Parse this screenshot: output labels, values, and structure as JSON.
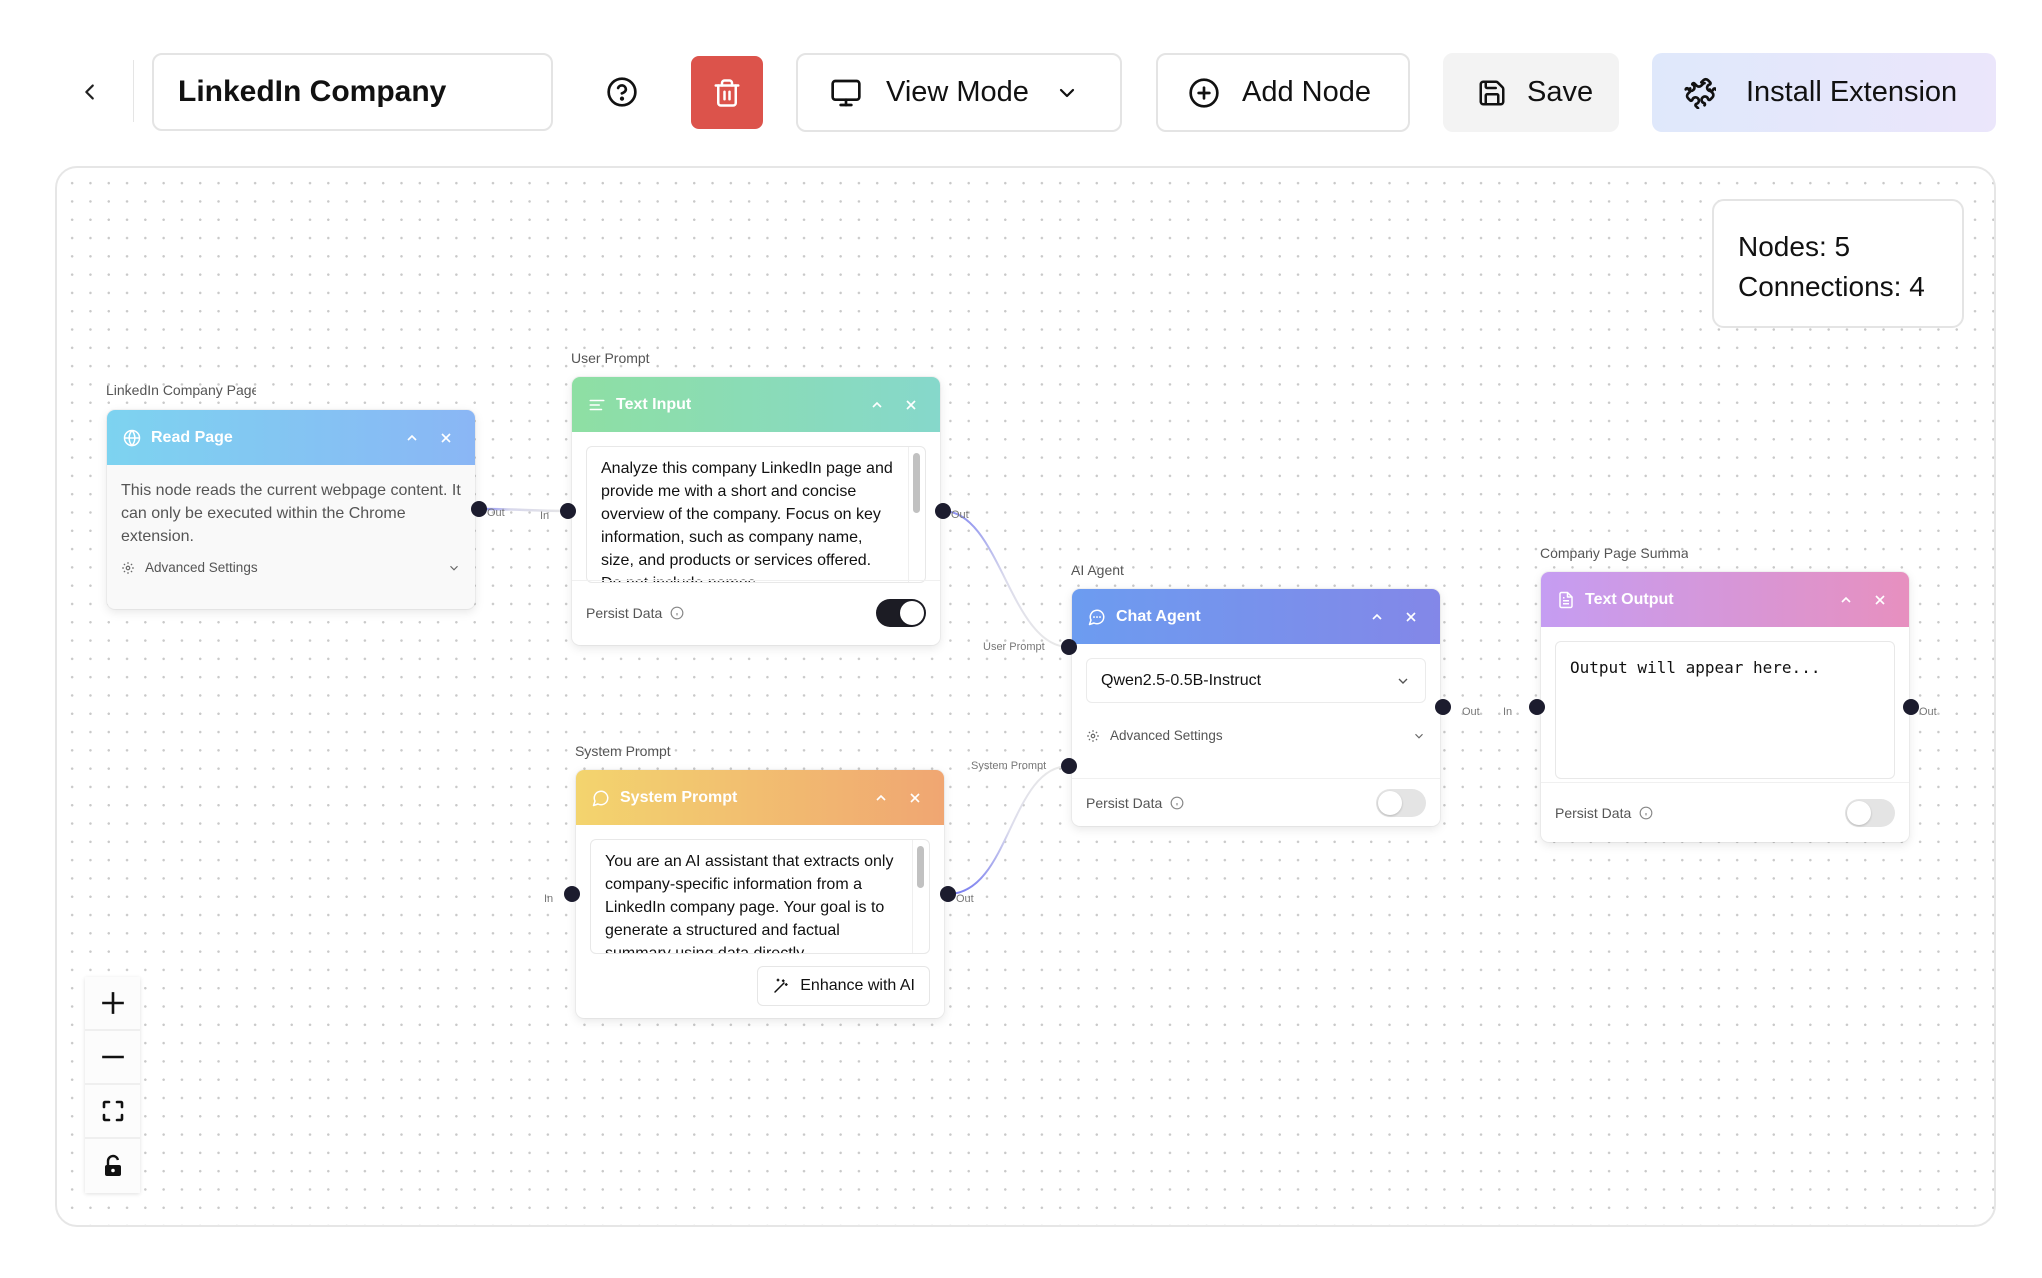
{
  "toolbar": {
    "back_icon": "chevron-left-icon",
    "title_value": "LinkedIn Company",
    "help_icon": "help-circle-icon",
    "delete_icon": "trash-icon",
    "view_mode_label": "View Mode",
    "view_mode_icon": "monitor-icon",
    "add_node_label": "Add Node",
    "add_node_icon": "plus-circle-icon",
    "save_label": "Save",
    "save_icon": "save-icon",
    "install_label": "Install Extension",
    "install_icon": "puzzle-icon"
  },
  "stats": {
    "nodes": "Nodes: 5",
    "connections": "Connections: 4"
  },
  "nodes": {
    "read_page": {
      "label": "LinkedIn Company Page",
      "title": "Read Page",
      "icon": "globe-icon",
      "header_colors": [
        "#7dd3f0",
        "#8ab6f5"
      ],
      "description": "This node reads the current webpage content. It can only be executed within the Chrome extension.",
      "advanced_settings": "Advanced Settings",
      "ports": {
        "out": "Out"
      }
    },
    "text_input": {
      "label": "User Prompt",
      "title": "Text Input",
      "icon": "text-align-icon",
      "header_colors": [
        "#8edfa3",
        "#86d8cb"
      ],
      "text": "Analyze this company LinkedIn page and provide me with a short and concise overview of the company. Focus on key information, such as company name, size, and products or services offered. Do not include names",
      "persist_label": "Persist Data",
      "persist_on": true,
      "ports": {
        "in": "In",
        "out": "Out"
      }
    },
    "system_prompt": {
      "label": "System Prompt",
      "title": "System Prompt",
      "icon": "message-circle-icon",
      "header_colors": [
        "#f3d46e",
        "#f0a672"
      ],
      "text": "You are an AI assistant that extracts only company-specific information from a LinkedIn company page. Your goal is to generate a structured and factual summary using data directly",
      "enhance_label": "Enhance with AI",
      "ports": {
        "in": "In",
        "out": "Out"
      }
    },
    "chat_agent": {
      "label": "AI Agent",
      "title": "Chat Agent",
      "icon": "message-dots-icon",
      "header_colors": [
        "#6c9cf0",
        "#8387e8"
      ],
      "model": "Qwen2.5-0.5B-Instruct",
      "advanced_settings": "Advanced Settings",
      "persist_label": "Persist Data",
      "persist_on": false,
      "ports": {
        "user_prompt": "User Prompt",
        "system_prompt": "System Prompt",
        "out": "Out"
      }
    },
    "text_output": {
      "label": "Company Page Summary",
      "title": "Text Output",
      "icon": "file-text-icon",
      "header_colors": [
        "#c59df2",
        "#e790bf"
      ],
      "placeholder": "Output will appear here...",
      "persist_label": "Persist Data",
      "persist_on": false,
      "ports": {
        "in": "In",
        "out": "Out"
      }
    }
  },
  "zoom_controls": [
    "zoom-in",
    "zoom-out",
    "fit-view",
    "toggle-lock"
  ],
  "colors": {
    "delete": "#dc534b",
    "port": "#1c1c2e",
    "edge": "#8b8ff0"
  }
}
